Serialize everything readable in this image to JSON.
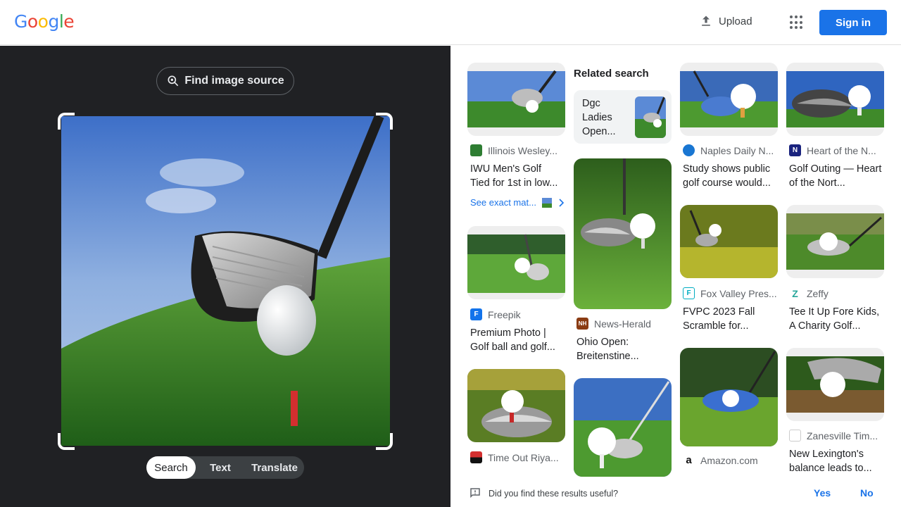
{
  "header": {
    "logo_letters": [
      {
        "ch": "G",
        "color": "#4285f4"
      },
      {
        "ch": "o",
        "color": "#ea4335"
      },
      {
        "ch": "o",
        "color": "#fbbc05"
      },
      {
        "ch": "g",
        "color": "#4285f4"
      },
      {
        "ch": "l",
        "color": "#34a853"
      },
      {
        "ch": "e",
        "color": "#ea4335"
      }
    ],
    "upload_label": "Upload",
    "upload_icon": "upload-icon",
    "apps_icon": "apps-grid-icon",
    "signin_label": "Sign in"
  },
  "lens": {
    "find_source_label": "Find image source",
    "find_source_icon": "lens-search-icon",
    "modes": [
      "Search",
      "Text",
      "Translate"
    ],
    "active_mode": "Search"
  },
  "results": {
    "related_heading": "Related search",
    "related_query": "Dgc Ladies Open...",
    "exact_match_label": "See exact mat...",
    "cards": [
      {
        "source": "Illinois Wesley...",
        "title": "IWU Men's Golf Tied for 1st in low...",
        "fav_color": "#2e7d32",
        "fav_text": ""
      },
      {
        "source": "Freepik",
        "title": "Premium Photo | Golf ball and golf...",
        "fav_color": "#1273eb",
        "fav_text": "F"
      },
      {
        "source": "Time Out Riya...",
        "title": "",
        "fav_color": "#d32f2f",
        "fav_text": ""
      },
      {
        "source": "News-Herald",
        "title": "Ohio Open: Breitenstine...",
        "fav_color": "#8a3b12",
        "fav_text": "NH"
      },
      {
        "source": "Naples Daily N...",
        "title": "Study shows public golf course would...",
        "fav_color": "#1976d2",
        "fav_text": ""
      },
      {
        "source": "Fox Valley Pres...",
        "title": "FVPC 2023 Fall Scramble for...",
        "fav_color": "#00acc1",
        "fav_text": "F"
      },
      {
        "source": "Amazon.com",
        "title": "",
        "fav_color": "#ffffff",
        "fav_text": "a"
      },
      {
        "source": "Heart of the N...",
        "title": "Golf Outing — Heart of the Nort...",
        "fav_color": "#1a237e",
        "fav_text": "N"
      },
      {
        "source": "Zeffy",
        "title": "Tee It Up Fore Kids, A Charity Golf...",
        "fav_color": "#26a69a",
        "fav_text": "Z"
      },
      {
        "source": "Zanesville Tim...",
        "title": "New Lexington's balance leads to...",
        "fav_color": "#1565c0",
        "fav_text": ""
      }
    ]
  },
  "feedback": {
    "question": "Did you find these results useful?",
    "yes_label": "Yes",
    "no_label": "No"
  }
}
